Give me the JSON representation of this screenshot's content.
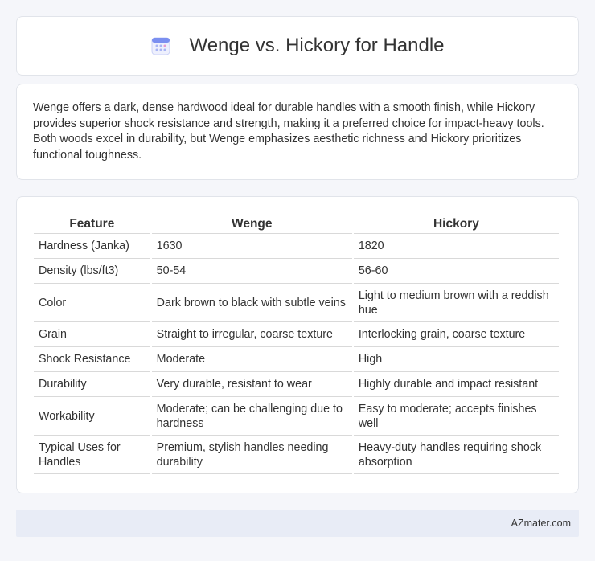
{
  "header": {
    "title": "Wenge vs. Hickory for Handle",
    "icon": "calendar-icon"
  },
  "summary": {
    "text": "Wenge offers a dark, dense hardwood ideal for durable handles with a smooth finish, while Hickory provides superior shock resistance and strength, making it a preferred choice for impact-heavy tools. Both woods excel in durability, but Wenge emphasizes aesthetic richness and Hickory prioritizes functional toughness."
  },
  "table": {
    "headers": [
      "Feature",
      "Wenge",
      "Hickory"
    ],
    "rows": [
      [
        "Hardness (Janka)",
        "1630",
        "1820"
      ],
      [
        "Density (lbs/ft3)",
        "50-54",
        "56-60"
      ],
      [
        "Color",
        "Dark brown to black with subtle veins",
        "Light to medium brown with a reddish hue"
      ],
      [
        "Grain",
        "Straight to irregular, coarse texture",
        "Interlocking grain, coarse texture"
      ],
      [
        "Shock Resistance",
        "Moderate",
        "High"
      ],
      [
        "Durability",
        "Very durable, resistant to wear",
        "Highly durable and impact resistant"
      ],
      [
        "Workability",
        "Moderate; can be challenging due to hardness",
        "Easy to moderate; accepts finishes well"
      ],
      [
        "Typical Uses for Handles",
        "Premium, stylish handles needing durability",
        "Heavy-duty handles requiring shock absorption"
      ]
    ]
  },
  "footer": {
    "text": "AZmater.com"
  },
  "colors": {
    "background": "#f5f6fa",
    "card": "#ffffff",
    "footer_bg": "#e8ecf6",
    "icon_accent": "#7b8ff0"
  }
}
